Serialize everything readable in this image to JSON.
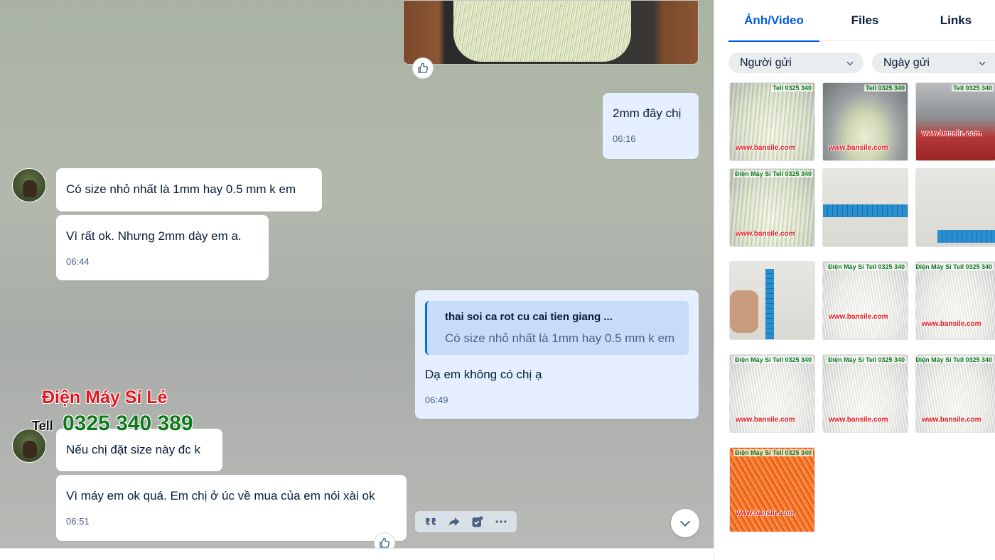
{
  "chat": {
    "messages": [
      {
        "id": "m1",
        "direction": "out",
        "text": "2mm đây chị",
        "time": "06:16"
      },
      {
        "id": "m2",
        "direction": "in",
        "text": "Có size nhỏ nhất là 1mm hay 0.5 mm k em"
      },
      {
        "id": "m3",
        "direction": "in",
        "text": "Vì rất ok. Nhưng 2mm dày em a.",
        "time": "06:44"
      },
      {
        "id": "m4",
        "direction": "out",
        "quote": {
          "sender": "thai soi ca rot cu cai tien giang ...",
          "text": "Có size nhỏ nhất là 1mm hay 0.5 mm k em"
        },
        "text": "Dạ em không có chị ạ",
        "time": "06:49"
      },
      {
        "id": "m5",
        "direction": "in",
        "text": "Nếu chị đặt size này đc k"
      },
      {
        "id": "m6",
        "direction": "in",
        "text": "Vì máy em ok quá. Em chị ở úc về mua của em nói xài ok",
        "time": "06:51"
      }
    ],
    "watermark": {
      "shop": "Điện Máy Sỉ Lẻ",
      "tell": "Tell",
      "phone": "0325 340 389"
    },
    "actions": {
      "quote": "quote-icon",
      "forward": "forward-icon",
      "task": "task-icon",
      "more": "more-icon"
    }
  },
  "panel": {
    "tabs": [
      {
        "label": "Ảnh/Video",
        "active": true
      },
      {
        "label": "Files",
        "active": false
      },
      {
        "label": "Links",
        "active": false
      }
    ],
    "filters": {
      "sender": "Người gửi",
      "date": "Ngày gửi"
    },
    "thumbnails": [
      {
        "kind": "cabbage",
        "watermark": "www.bansile.com",
        "tag": "Tell 0325 340"
      },
      {
        "kind": "machine",
        "watermark": "www.bansile.com",
        "tag": "Tell 0325 340"
      },
      {
        "kind": "red",
        "watermark": "www.bansile.com",
        "tag": "Tell 0325 340"
      },
      {
        "kind": "cabbage",
        "watermark": "www.bansile.com",
        "tag": "Điện Máy Sỉ Tell 0325 340"
      },
      {
        "kind": "tape",
        "watermark": "",
        "tag": ""
      },
      {
        "kind": "tape2",
        "watermark": "",
        "tag": ""
      },
      {
        "kind": "vtape",
        "watermark": "",
        "tag": ""
      },
      {
        "kind": "white",
        "watermark": "www.bansile.com",
        "tag": "Điện Máy Sỉ Tell 0325 340"
      },
      {
        "kind": "white",
        "watermark": "www.bansile.com",
        "tag": "Điện Máy Sỉ Tell 0325 340"
      },
      {
        "kind": "white",
        "watermark": "www.bansile.com",
        "tag": "Điện Máy Sỉ Tell 0325 340"
      },
      {
        "kind": "white",
        "watermark": "www.bansile.com",
        "tag": "Điện Máy Sỉ Tell 0325 340"
      },
      {
        "kind": "white",
        "watermark": "www.bansile.com",
        "tag": "Điện Máy Sỉ Tell 0325 340"
      },
      {
        "kind": "carrot",
        "watermark": "www.bansile.com",
        "tag": "Điện Máy Sỉ Tell 0325 340"
      }
    ]
  },
  "colors": {
    "accent": "#005ae0",
    "outgoing_bubble": "#e5efff",
    "incoming_bubble": "#ffffff",
    "watermark_red": "#e4161c",
    "watermark_green": "#0d7a1a"
  }
}
